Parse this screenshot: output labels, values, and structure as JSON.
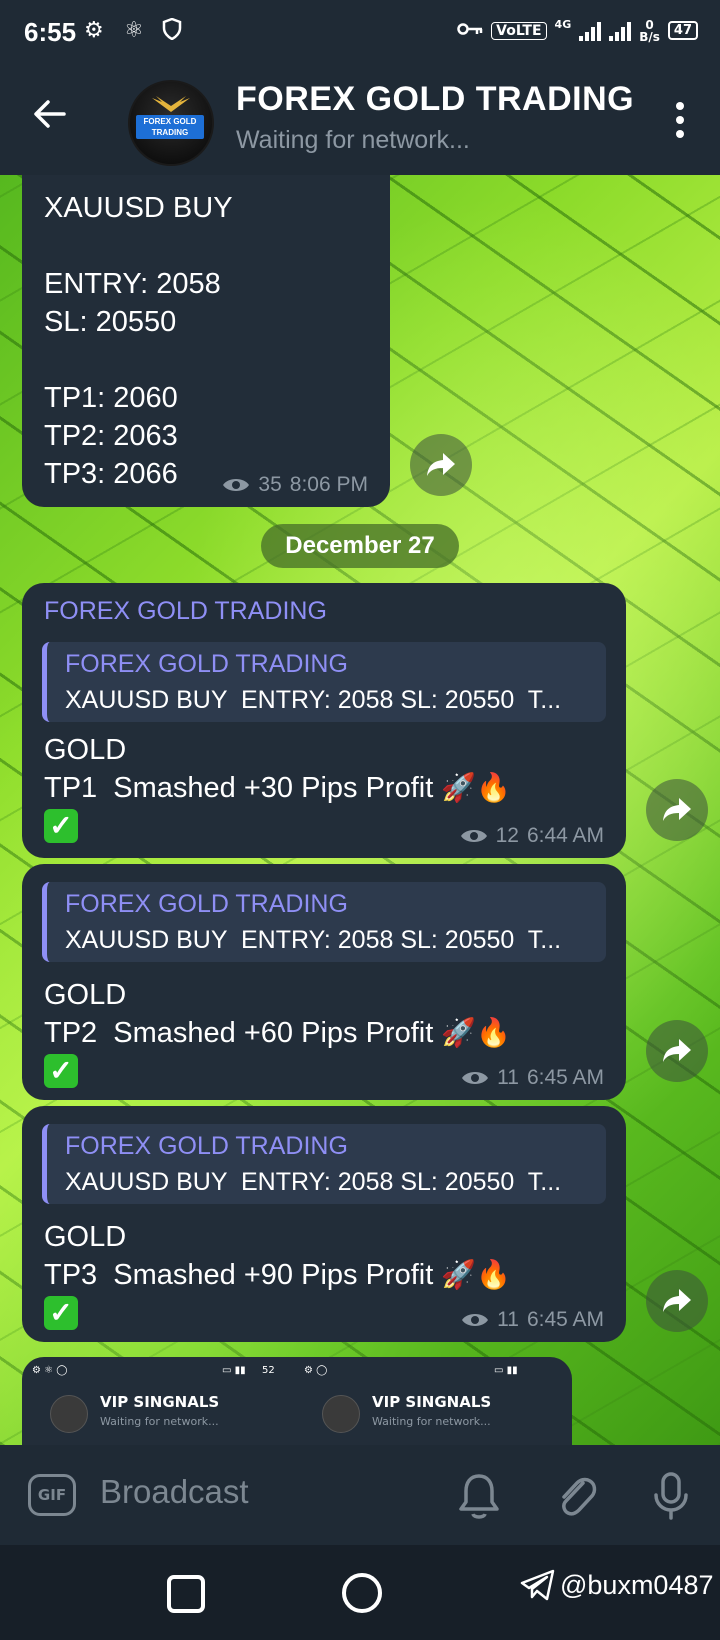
{
  "status_bar": {
    "time": "6:55",
    "volte": "VoLTE",
    "network": "4G",
    "speed_top": "0",
    "speed_bottom": "B/s",
    "battery": "47"
  },
  "header": {
    "title": "FOREX GOLD TRADING",
    "subtitle": "Waiting for network...",
    "avatar_text": "FOREX GOLD\nTRADING"
  },
  "messages": [
    {
      "text": "XAUUSD BUY\n\nENTRY: 2058\nSL: 20550\n\nTP1: 2060\nTP2: 2063\nTP3: 2066",
      "views": "35",
      "time": "8:06 PM"
    }
  ],
  "date_separator": "December 27",
  "replies": [
    {
      "sender": "FOREX GOLD TRADING",
      "reply_name": "FOREX GOLD TRADING",
      "reply_text": "XAUUSD BUY  ENTRY: 2058 SL: 20550  T...",
      "line1": "GOLD",
      "line2": "TP1  Smashed +30 Pips Profit ",
      "views": "12",
      "time": "6:44 AM"
    },
    {
      "reply_name": "FOREX GOLD TRADING",
      "reply_text": "XAUUSD BUY  ENTRY: 2058 SL: 20550  T...",
      "line1": "GOLD",
      "line2": "TP2  Smashed +60 Pips Profit ",
      "views": "11",
      "time": "6:45 AM"
    },
    {
      "reply_name": "FOREX GOLD TRADING",
      "reply_text": "XAUUSD BUY  ENTRY: 2058 SL: 20550  T...",
      "line1": "GOLD",
      "line2": "TP3  Smashed +90 Pips Profit ",
      "views": "11",
      "time": "6:45 AM"
    }
  ],
  "preview": {
    "left_title": "VIP SINGNALS",
    "left_sub": "Waiting for network...",
    "right_title": "VIP SINGNALS",
    "right_sub": "Waiting for network...",
    "mid_num": "52"
  },
  "composer": {
    "gif_label": "GIF",
    "placeholder": "Broadcast"
  },
  "watermark": "@buxm0487",
  "colors": {
    "bubble": "#222d39",
    "accent_name": "#8f8ff5",
    "header_bg": "#1f2a35"
  }
}
